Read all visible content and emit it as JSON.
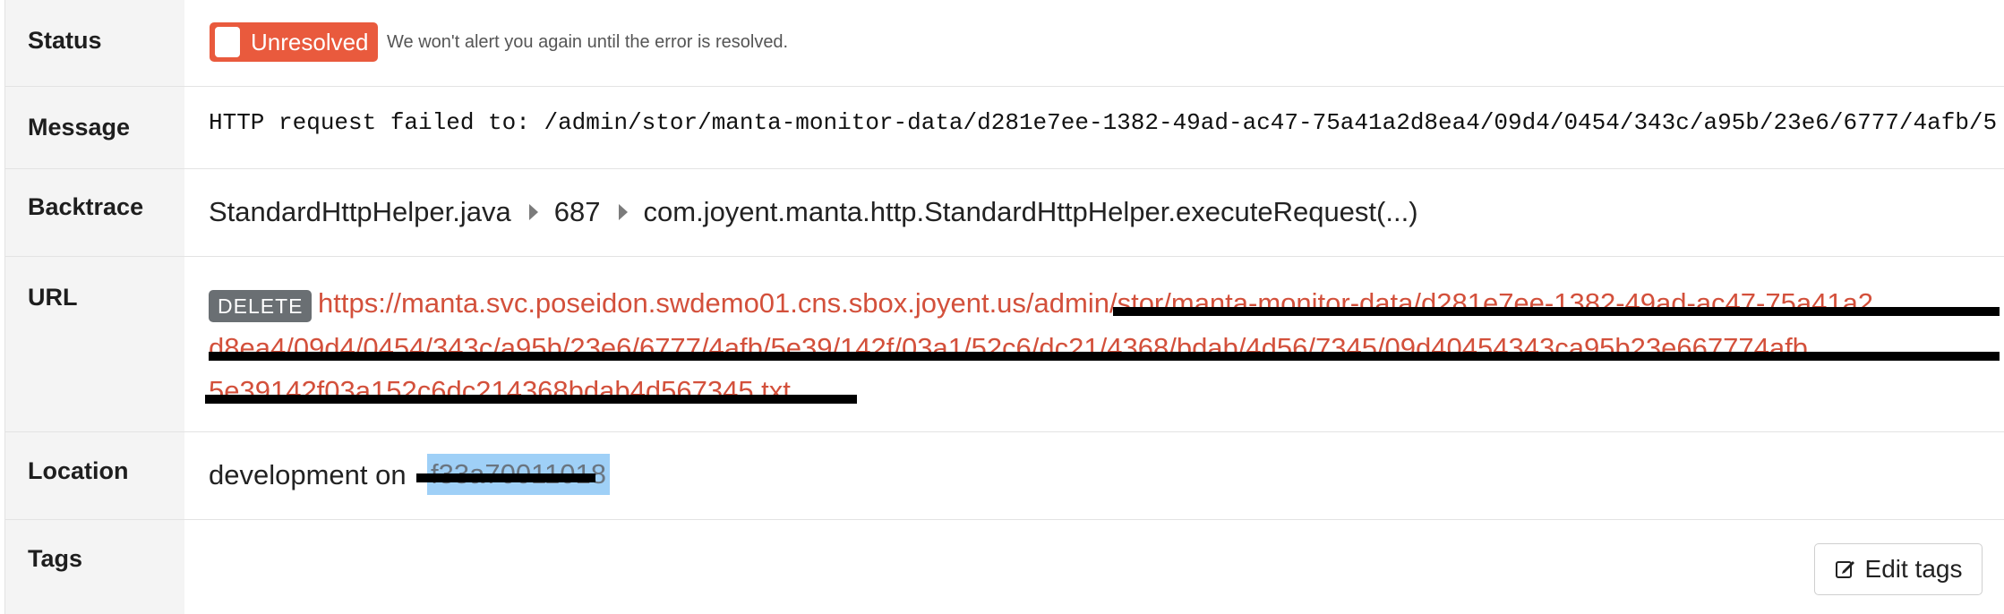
{
  "labels": {
    "status": "Status",
    "message": "Message",
    "backtrace": "Backtrace",
    "url": "URL",
    "location": "Location",
    "tags": "Tags"
  },
  "status": {
    "badge": "Unresolved",
    "note": "We won't alert you again until the error is resolved.",
    "badge_color": "#e95a3d"
  },
  "message": {
    "text": "HTTP request failed to: /admin/stor/manta-monitor-data/d281e7ee-1382-49ad-ac47-75a41a2d8ea4/09d4/0454/343c/a95b/23e6/6777/4afb/5"
  },
  "backtrace": {
    "file": "StandardHttpHelper.java",
    "line": "687",
    "method": "com.joyent.manta.http.StandardHttpHelper.executeRequest(...)"
  },
  "url": {
    "method": "DELETE",
    "line1": "https://manta.svc.poseidon.swdemo01.cns.sbox.joyent.us/admin/stor/manta-monitor-data/d281e7ee-1382-49ad-ac47-75a41a2",
    "line2": "d8ea4/09d4/0454/343c/a95b/23e6/6777/4afb/5e39/142f/03a1/52c6/dc21/4368/bdab/4d56/7345/09d40454343ca95b23e667774afb",
    "line3": "5e39142f03a152c6dc214368bdab4d567345.txt",
    "link_color": "#d3503b"
  },
  "location": {
    "text": "development on",
    "host": "f33a70011018"
  },
  "tags": {
    "edit_label": "Edit tags"
  }
}
